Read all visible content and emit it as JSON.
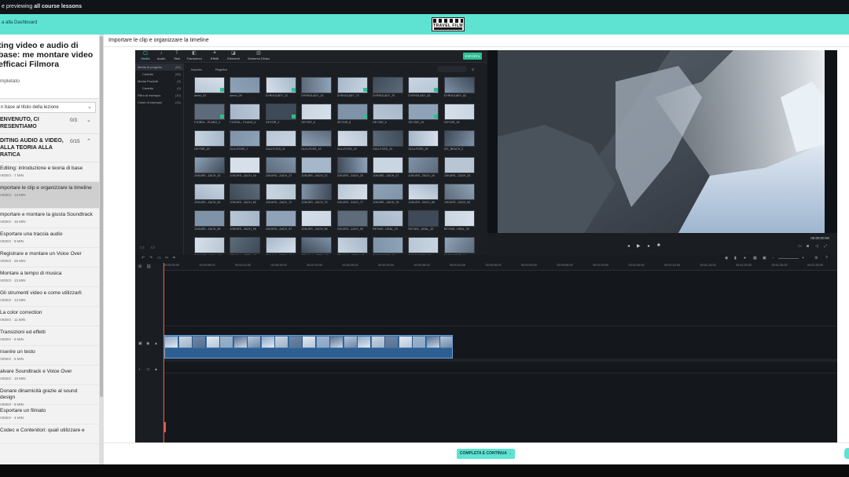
{
  "topbar": {
    "text_prefix": "e previewing",
    "text_bold": "all course lessons"
  },
  "header": {
    "back_label": "a alla Dashboard",
    "logo_text": "TRAVEL FILM"
  },
  "sidebar": {
    "course_title": "ting video e audio di base: me montare video efficaci Filmora",
    "completed": "mpletato",
    "search": "n base al titolo della lezione",
    "sections": [
      {
        "title": "ENVENUTO, CI RESENTIAMO",
        "count": "0/3"
      },
      {
        "title": "DITING AUDIO & VIDEO, ALLA TEORIA ALLA RATICA",
        "count": "0/15"
      }
    ],
    "lessons": [
      {
        "title": "Editing: introduzione e teoria di base",
        "meta": "VIDEO · 7 MIN"
      },
      {
        "title": "mportare le clip e organizzare la timeline",
        "meta": "VIDEO · 13 MIN"
      },
      {
        "title": "mportare e montare la giusta Soundtrack",
        "meta": "VIDEO · 16 MIN"
      },
      {
        "title": "Esportare una traccia audio",
        "meta": "VIDEO · 8 MIN"
      },
      {
        "title": "Registrare e montare un Voice Over",
        "meta": "VIDEO · 25 MIN"
      },
      {
        "title": "Montare a tempo di musica",
        "meta": "VIDEO · 13 MIN"
      },
      {
        "title": "Gli strumenti video e come utilizzarli",
        "meta": "VIDEO · 13 MIN"
      },
      {
        "title": "La color correction",
        "meta": "VIDEO · 11 MIN"
      },
      {
        "title": "Transizioni ed effetti",
        "meta": "VIDEO · 9 MIN"
      },
      {
        "title": "nserire un testo",
        "meta": "VIDEO · 6 MIN"
      },
      {
        "title": "alvare Soundtrack e Voice Over",
        "meta": "VIDEO · 10 MIN"
      },
      {
        "title": "Donare dinamicità grazie al sound design",
        "meta": "VIDEO · 8 MIN"
      },
      {
        "title": "Esportare un filmato",
        "meta": "VIDEO · 4 MIN"
      },
      {
        "title": "Codec e Contenitori: quali utilizzare e",
        "meta": ""
      }
    ]
  },
  "main": {
    "lesson_title": "Importare le clip e organizzare la timeline",
    "complete_button": "COMPLETA E CONTINUA  →"
  },
  "editor": {
    "tabs": [
      "Media",
      "Audio",
      "Titoli",
      "Transizioni",
      "Effetti",
      "Elementi",
      "Schermo Diviso"
    ],
    "export": "ESPORTA",
    "folders": [
      {
        "label": "Media di progetto",
        "count": "(83)"
      },
      {
        "label": "Cartella",
        "count": "(83)"
      },
      {
        "label": "Media Prodotti",
        "count": "(0)"
      },
      {
        "label": "Cartella",
        "count": "(0)"
      },
      {
        "label": "Filtro di esempio",
        "count": "(20)"
      },
      {
        "label": "Colori di esempio",
        "count": "(15)"
      }
    ],
    "filters": [
      "Importa",
      "Registra"
    ],
    "thumb_labels": [
      [
        "aereo_01",
        "aereo_09",
        "DYRHOLAEY_12",
        "DYRHOLAEY_13",
        "DYRHOLAEY_72",
        "DYRHOLAEY_75",
        "DYRHOLAEY_81",
        "DYRHOLAEY_82"
      ],
      [
        "FJORDL...PLANO_4",
        "FJORDL...PLANO_6",
        "GEYSIR_2",
        "GEYSIR_6",
        "GEYSIR_8",
        "GEYSIR_9",
        "GEYSIR_15",
        "GEYSIR_16"
      ],
      [
        "GEYSIR_20",
        "GULLFOSS_7",
        "GULLFOSS_11",
        "GULLFOSS_13",
        "GULLFOSS_22",
        "GULLFOSS_24",
        "GULLFOSS_25",
        "ICE_BEACH_2"
      ],
      [
        "JOKURS...ZACH_15",
        "JOKURS...ZACH_16",
        "JOKURS...ZACH_17",
        "JOKURS...ZACH_22",
        "JOKURS...ZACH_23",
        "JOKURS...ZACH_27",
        "JOKURS...ZACH_28",
        "JOKURS...ZACH_33"
      ],
      [
        "JOKURS...ZACH_63",
        "JOKURS...ZACH_65",
        "JOKURS...ZACH_72",
        "JOKURS...ZACH_75",
        "JOKURS...ZACH_77",
        "JOKURS...ZACH_78",
        "JOKURS...ZACH_88",
        "JOKURS...ZACH_93"
      ],
      [
        "JOKURS...ZACH_95",
        "JOKURS...ZACH_96",
        "JOKURS...ZACH_97",
        "JOKURS...ZACH_98",
        "JOKURS...ZACH_99",
        "REYNIS...URAL_23",
        "REYNIS...URAL_32",
        "REYNIS...URAL_35"
      ],
      [
        "REYNIST...URAL_169",
        "SEUALA...ISTRA_17",
        "SEUALA...ISTRA_19",
        "SELJALA...ISTRA_21",
        "SELJALA...ISTRA_25",
        "SKOGAFOSS_02",
        "SKOGAFOSS_03",
        "SKOGAFOSS_04"
      ],
      [
        "",
        "",
        "",
        "",
        "",
        "",
        "",
        ""
      ]
    ],
    "timecode": "00:00:00:00",
    "ruler_ticks": [
      "00:00:00:00",
      "00:00:05:00",
      "00:00:10:00",
      "00:00:15:00",
      "00:00:20:00",
      "00:00:25:00",
      "00:00:30:00",
      "00:00:35:00",
      "00:00:40:00",
      "00:00:45:00",
      "00:00:50:00",
      "00:00:55:00",
      "00:01:00:00",
      "00:01:05:00",
      "00:01:10:00",
      "00:01:15:00",
      "00:01:20:00",
      "00:01:25:00",
      "00:01:30:00"
    ]
  },
  "colors": {
    "accent": "#5ee3d2",
    "export_green": "#2fbf93",
    "clip_blue": "#3a6fa8",
    "playhead": "#e05a4a"
  }
}
